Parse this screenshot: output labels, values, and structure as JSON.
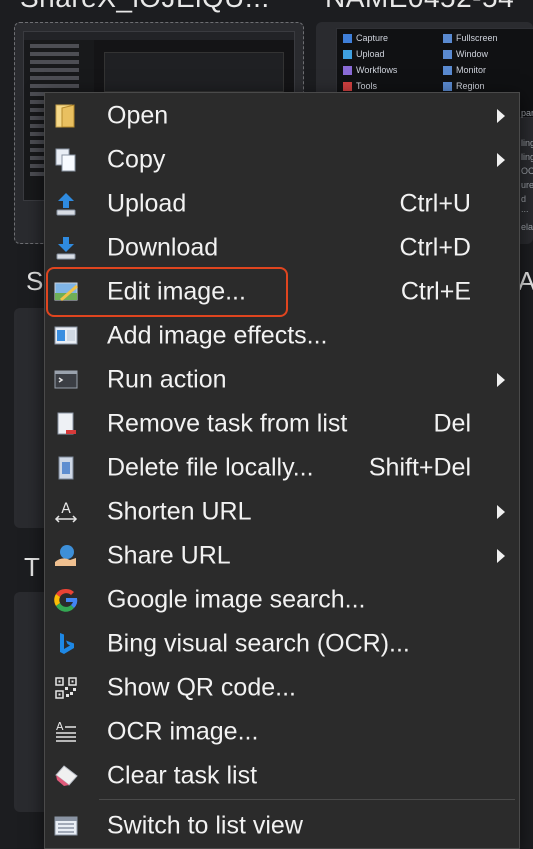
{
  "background": {
    "title_left": "ShareX_iOJEiQU...",
    "title_right": "NAME0452-54",
    "mini_menu": {
      "items_left": [
        "Capture",
        "Upload",
        "Workflows",
        "Tools"
      ],
      "items_right": [
        "Fullscreen",
        "Window",
        "Monitor",
        "Region"
      ]
    },
    "heading_1": "S",
    "heading_1_right": "A",
    "heading_2": "T",
    "right_fragments": [
      "par",
      "ling",
      "ling",
      "OCR",
      "ure",
      "d ...",
      "elay"
    ]
  },
  "menu": {
    "items": [
      {
        "label": "Open",
        "shortcut": "",
        "submenu": true,
        "icon": "folder-open-icon"
      },
      {
        "label": "Copy",
        "shortcut": "",
        "submenu": true,
        "icon": "copy-icon"
      },
      {
        "label": "Upload",
        "shortcut": "Ctrl+U",
        "submenu": false,
        "icon": "upload-icon"
      },
      {
        "label": "Download",
        "shortcut": "Ctrl+D",
        "submenu": false,
        "icon": "download-icon"
      },
      {
        "label": "Edit image...",
        "shortcut": "Ctrl+E",
        "submenu": false,
        "icon": "edit-image-icon"
      },
      {
        "label": "Add image effects...",
        "shortcut": "",
        "submenu": false,
        "icon": "image-effects-icon"
      },
      {
        "label": "Run action",
        "shortcut": "",
        "submenu": true,
        "icon": "terminal-icon"
      },
      {
        "label": "Remove task from list",
        "shortcut": "Del",
        "submenu": false,
        "icon": "remove-task-icon"
      },
      {
        "label": "Delete file locally...",
        "shortcut": "Shift+Del",
        "submenu": false,
        "icon": "delete-file-icon"
      },
      {
        "label": "Shorten URL",
        "shortcut": "",
        "submenu": true,
        "icon": "shorten-url-icon"
      },
      {
        "label": "Share URL",
        "shortcut": "",
        "submenu": true,
        "icon": "share-url-icon"
      },
      {
        "label": "Google image search...",
        "shortcut": "",
        "submenu": false,
        "icon": "google-icon"
      },
      {
        "label": "Bing visual search (OCR)...",
        "shortcut": "",
        "submenu": false,
        "icon": "bing-icon"
      },
      {
        "label": "Show QR code...",
        "shortcut": "",
        "submenu": false,
        "icon": "qr-code-icon"
      },
      {
        "label": "OCR image...",
        "shortcut": "",
        "submenu": false,
        "icon": "ocr-icon"
      },
      {
        "label": "Clear task list",
        "shortcut": "",
        "submenu": false,
        "icon": "eraser-icon"
      },
      {
        "label": "Switch to list view",
        "shortcut": "",
        "submenu": false,
        "icon": "list-view-icon"
      }
    ],
    "highlighted_item": "Edit image...",
    "highlight_color": "#e0451f"
  }
}
